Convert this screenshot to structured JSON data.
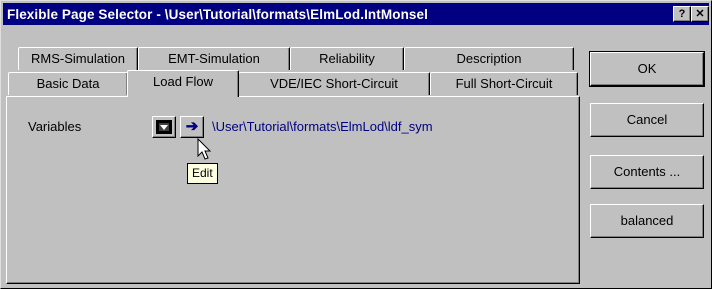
{
  "window": {
    "title": "Flexible Page Selector - \\User\\Tutorial\\formats\\ElmLod.IntMonsel",
    "help_label": "?",
    "close_label": "✕"
  },
  "tabs": {
    "back_row": [
      "RMS-Simulation",
      "EMT-Simulation",
      "Reliability",
      "Description"
    ],
    "front_row": [
      "Basic Data",
      "Load Flow",
      "VDE/IEC Short-Circuit",
      "Full Short-Circuit"
    ],
    "active": "Load Flow"
  },
  "panel": {
    "variables_label": "Variables",
    "dropdown_icon": "dropdown-icon",
    "jump_icon": "arrow-right-icon",
    "path": "\\User\\Tutorial\\formats\\ElmLod\\ldf_sym",
    "tooltip": "Edit"
  },
  "buttons": {
    "ok": "OK",
    "cancel": "Cancel",
    "contents": "Contents ...",
    "balanced": "balanced"
  },
  "colors": {
    "title_bar": "#000080",
    "face": "#c0c0c0",
    "link": "#000080",
    "tooltip_bg": "#ffffe1"
  }
}
